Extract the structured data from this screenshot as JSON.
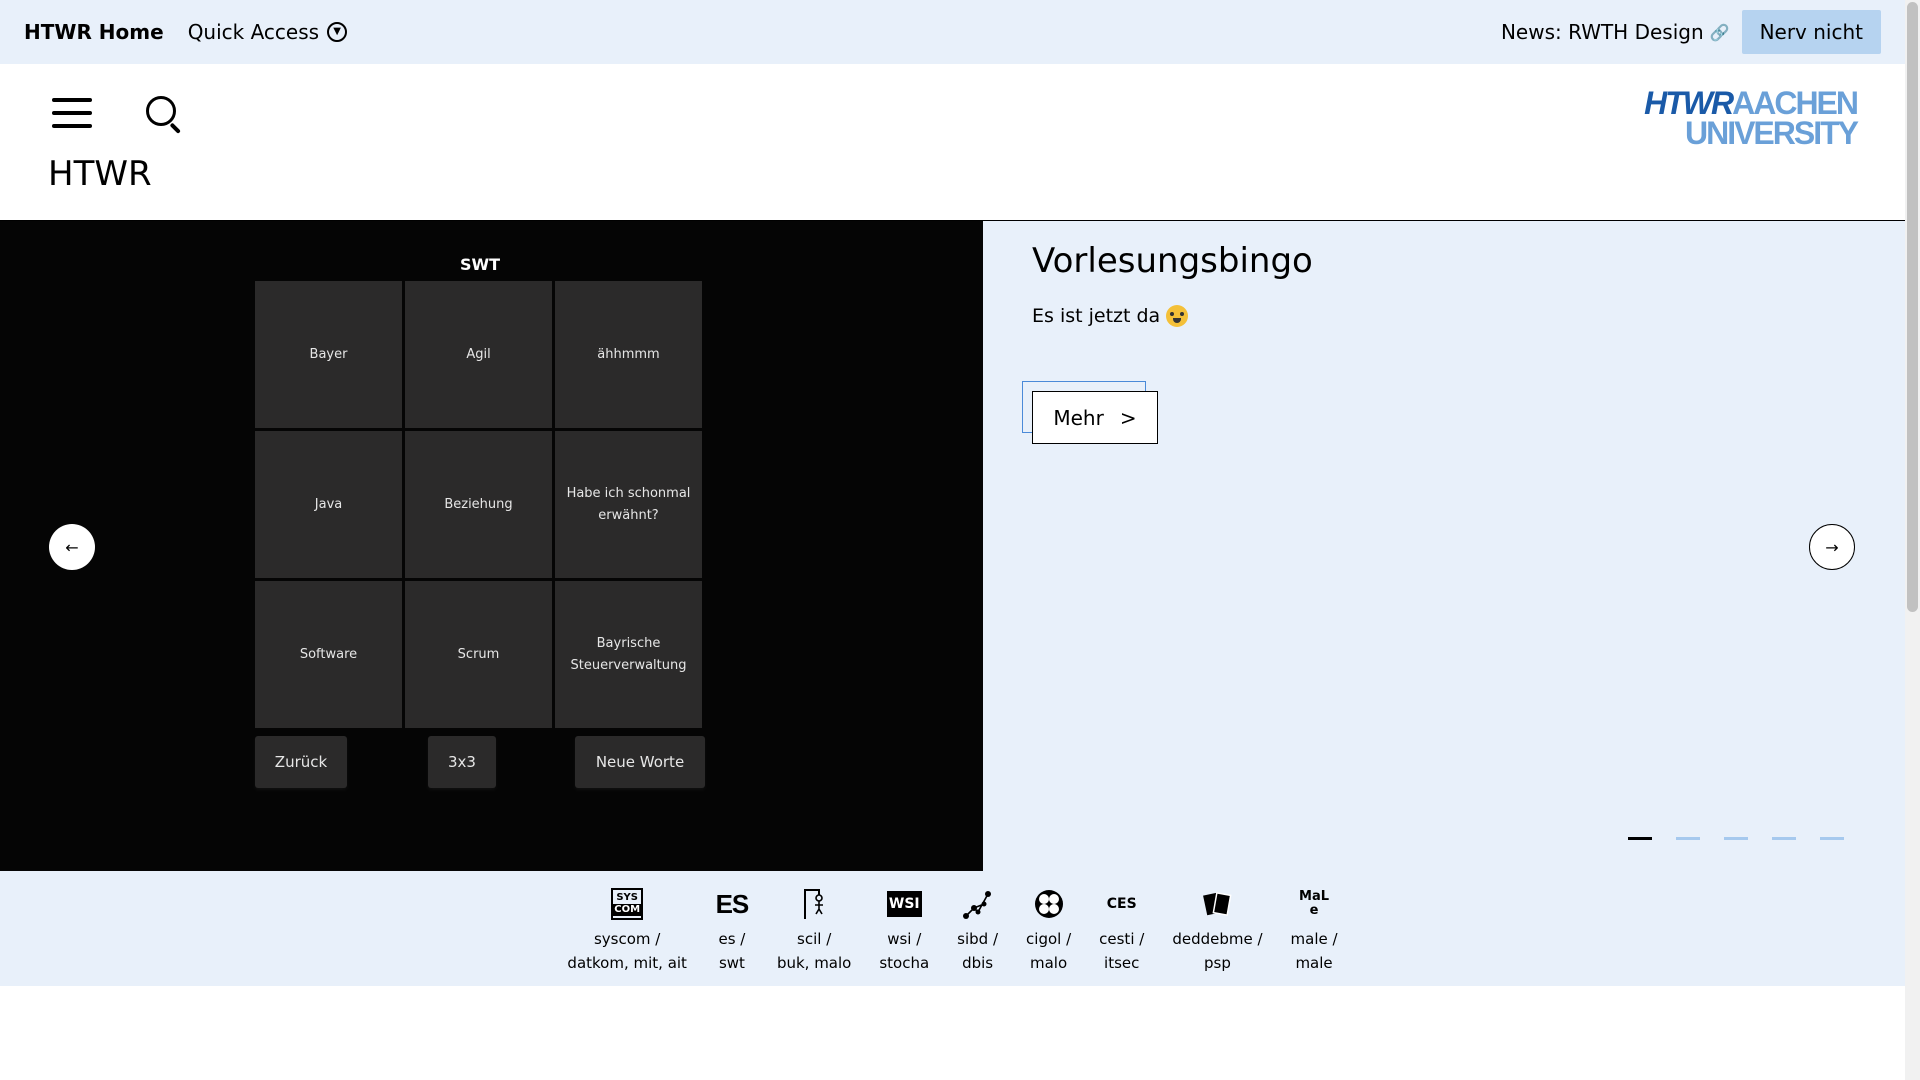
{
  "topbar": {
    "home": "HTWR Home",
    "quick_access": "Quick Access",
    "news": "News: RWTH Design",
    "nerv_nicht": "Nerv nicht"
  },
  "header": {
    "title": "HTWR",
    "logo_line1_a": "HTWR",
    "logo_line1_b": "AACHEN",
    "logo_line2": "UNIVERSITY"
  },
  "carousel": {
    "slide": {
      "bingo_title": "SWT",
      "cells": [
        "Bayer",
        "Agil",
        "ähhmmm",
        "Java",
        "Beziehung",
        "Habe ich schonmal erwähnt?",
        "Software",
        "Scrum",
        "Bayrische Steuerverwaltung"
      ],
      "controls": {
        "back": "Zurück",
        "size": "3x3",
        "new_words": "Neue Worte"
      },
      "heading": "Vorlesungsbingo",
      "description": "Es ist jetzt da",
      "more": "Mehr",
      "more_arrow": ">"
    },
    "prev_icon": "arrow-left",
    "next_icon": "arrow-right",
    "active_dot": 0,
    "dot_count": 5
  },
  "quicklinks": [
    {
      "line1": "syscom /",
      "line2": "datkom, mit, ait",
      "icon": "syscom-icon"
    },
    {
      "line1": "es /",
      "line2": "swt",
      "icon": "es-icon",
      "glyph": "ES"
    },
    {
      "line1": "scil /",
      "line2": "buk, malo",
      "icon": "hangman-icon"
    },
    {
      "line1": "wsi /",
      "line2": "stocha",
      "icon": "wsi-icon",
      "glyph": "WSI"
    },
    {
      "line1": "sibd /",
      "line2": "dbis",
      "icon": "graph-icon"
    },
    {
      "line1": "cigol /",
      "line2": "malo",
      "icon": "cigol-icon"
    },
    {
      "line1": "cesti /",
      "line2": "itsec",
      "icon": "cesti-icon",
      "glyph": "CES"
    },
    {
      "line1": "deddebme /",
      "line2": "psp",
      "icon": "cards-icon"
    },
    {
      "line1": "male /",
      "line2": "male",
      "icon": "male-icon",
      "glyph": "MaLe"
    }
  ],
  "colors": {
    "bar_bg": "#e8f0fa",
    "accent_btn": "#b6d3f0",
    "logo_dark": "#1a5aa8",
    "logo_light": "#6aa0d8",
    "dot_inactive": "#a6c9ee"
  }
}
